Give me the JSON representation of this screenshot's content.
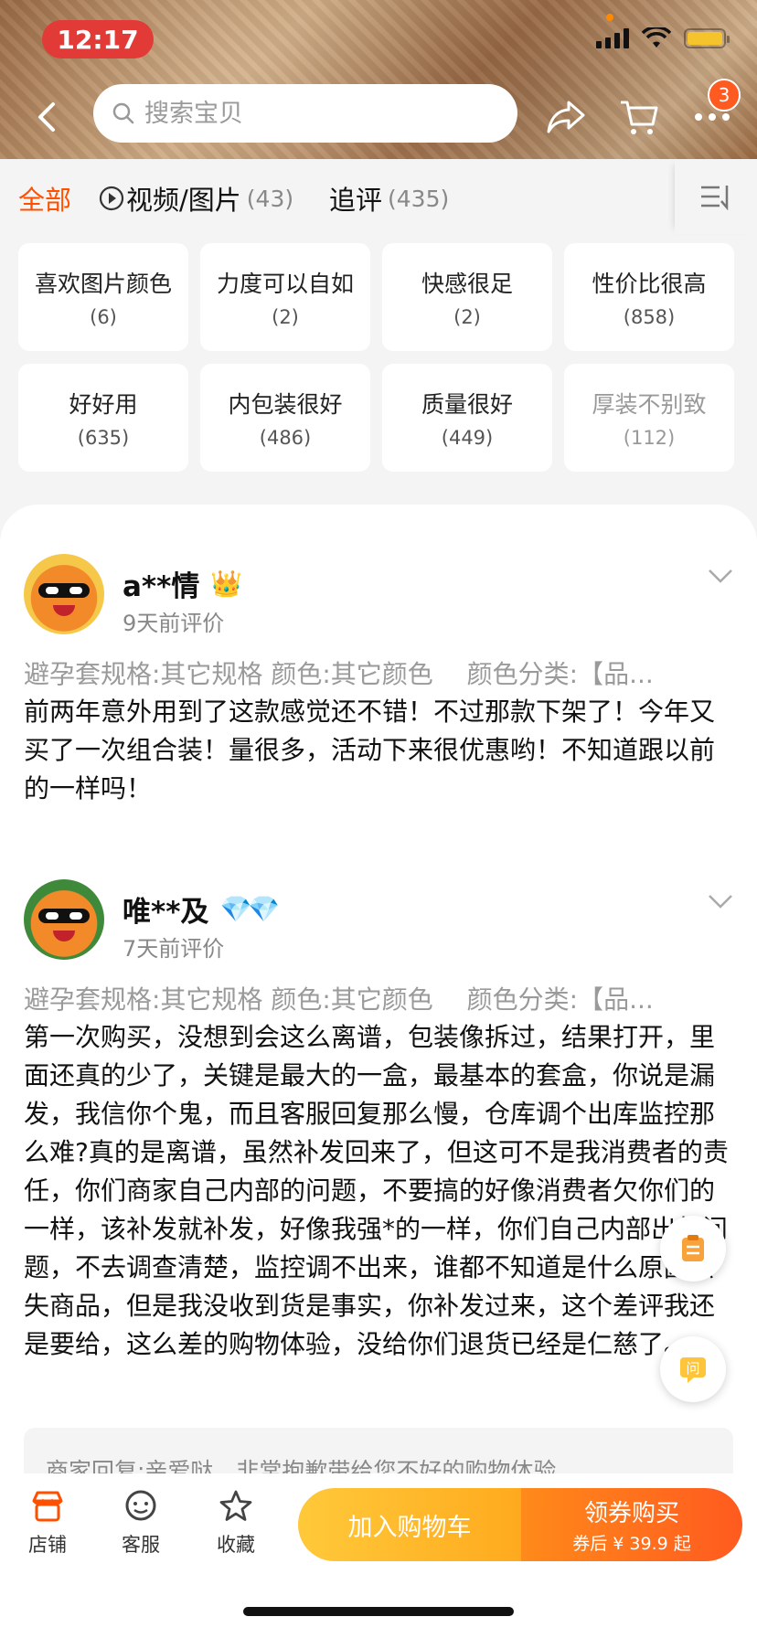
{
  "status": {
    "time": "12:17"
  },
  "header": {
    "search_placeholder": "搜索宝贝",
    "badge_count": "3"
  },
  "tabs": {
    "all": "全部",
    "video_label": "视频/图片",
    "video_count": "(43)",
    "follow_label": "追评",
    "follow_count": "(435)"
  },
  "tags": [
    {
      "label": "喜欢图片颜色",
      "count": "(6)"
    },
    {
      "label": "力度可以自如",
      "count": "(2)"
    },
    {
      "label": "快感很足",
      "count": "(2)"
    },
    {
      "label": "性价比很高",
      "count": "(858)"
    },
    {
      "label": "好好用",
      "count": "(635)"
    },
    {
      "label": "内包装很好",
      "count": "(486)"
    },
    {
      "label": "质量很好",
      "count": "(449)"
    },
    {
      "label": "厚装不别致",
      "count": "(112)"
    }
  ],
  "reviews": [
    {
      "user": "a**情",
      "date": "9天前评价",
      "spec": "避孕套规格:其它规格 颜色:其它颜色　 颜色分类:【品...",
      "text": "前两年意外用到了这款感觉还不错！不过那款下架了！今年又买了一次组合装！量很多，活动下来很优惠哟！不知道跟以前的一样吗！"
    },
    {
      "user": "唯**及",
      "date": "7天前评价",
      "spec": "避孕套规格:其它规格 颜色:其它颜色　 颜色分类:【品...",
      "text": "第一次购买，没想到会这么离谱，包装像拆过，结果打开，里面还真的少了，关键是最大的一盒，最基本的套盒，你说是漏发，我信你个鬼，而且客服回复那么慢，仓库调个出库监控那么难?真的是离谱，虽然补发回来了，但这可不是我消费者的责任，你们商家自己内部的问题，不要搞的好像消费者欠你们的一样，该补发就补发，好像我强*的一样，你们自己内部出的问题，不去调查清楚，监控调不出来，谁都不知道是什么原因丢失商品，但是我没收到货是事实，你补发过来，这个差评我还是要给，这么差的购物体验，没给你们退货已经是仁慈了。"
    }
  ],
  "reply": "商家回复:亲爱哒，非常抱歉带给您不好的购物体验",
  "bottom": {
    "shop": "店铺",
    "service": "客服",
    "favorite": "收藏",
    "add_cart": "加入购物车",
    "buy_main": "领券购买",
    "buy_sub": "券后 ¥ 39.9 起"
  },
  "colors": {
    "accent": "#ff5000",
    "cart": "#ffb72a",
    "buy": "#ff6a1f"
  }
}
